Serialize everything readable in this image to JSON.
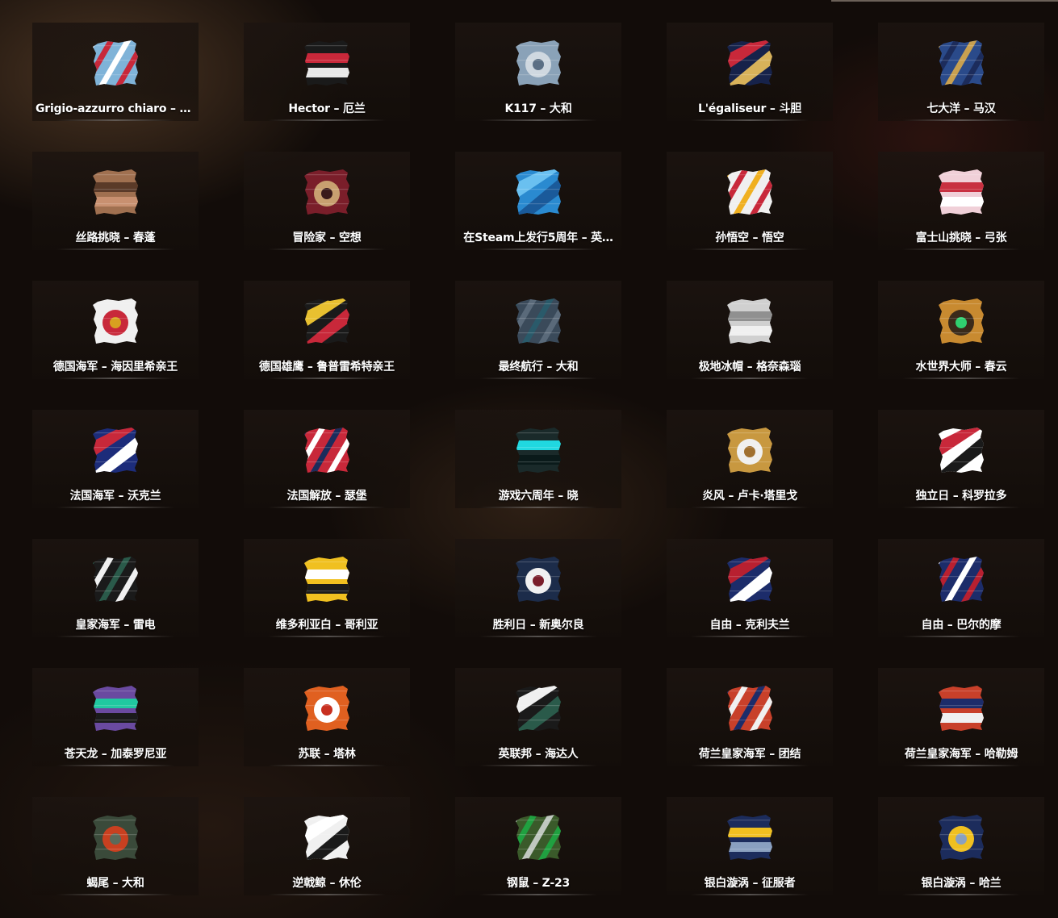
{
  "items": [
    {
      "label": "Grigio-azzurro chiaro – 威…",
      "icon": "camo-light-blue-stripes-icon",
      "colors": [
        "#7fb3d8",
        "#ffffff",
        "#c8283a"
      ]
    },
    {
      "label": "Hector – 厄兰",
      "icon": "camo-hector-turbine-icon",
      "colors": [
        "#1a1a1a",
        "#c8283a",
        "#e8e8e8"
      ]
    },
    {
      "label": "K117 – 大和",
      "icon": "camo-k117-grey-blue-icon",
      "colors": [
        "#8aa2b8",
        "#cfd8e0",
        "#5b6f84"
      ]
    },
    {
      "label": "L'égaliseur – 斗胆",
      "icon": "camo-egaliseur-navy-icon",
      "colors": [
        "#16224a",
        "#d8b25a",
        "#c8283a"
      ]
    },
    {
      "label": "七大洋 – 马汉",
      "icon": "camo-seven-seas-gold-icon",
      "colors": [
        "#2a4a8a",
        "#c8a050",
        "#1c2c5c"
      ]
    },
    {
      "label": "丝路挑晓 – 春蓬",
      "icon": "camo-silk-road-brown-icon",
      "colors": [
        "#a07050",
        "#5a3a28",
        "#c89070"
      ]
    },
    {
      "label": "冒险家 – 空想",
      "icon": "camo-adventurer-red-icon",
      "colors": [
        "#7a1e2a",
        "#c8a070",
        "#3a1a1a"
      ]
    },
    {
      "label": "在Steam上发行5周年 – 英…",
      "icon": "camo-steam-anniversary-blue-icon",
      "colors": [
        "#2a8ad0",
        "#1a5a9a",
        "#6ac0f0"
      ]
    },
    {
      "label": "孙悟空 – 悟空",
      "icon": "camo-wukong-cloud-icon",
      "colors": [
        "#f0f0f0",
        "#f0b020",
        "#c8283a"
      ]
    },
    {
      "label": "富士山挑晓 – 弓张",
      "icon": "camo-fuji-cherry-icon",
      "colors": [
        "#f0d0d8",
        "#c83040",
        "#ffffff"
      ]
    },
    {
      "label": "德国海军 – 海因里希亲王",
      "icon": "camo-german-navy-icon",
      "colors": [
        "#f0f0f0",
        "#c8283a",
        "#d8a020"
      ]
    },
    {
      "label": "德国雄鹰 – 鲁普雷希特亲王",
      "icon": "camo-german-eagle-icon",
      "colors": [
        "#1a1a1a",
        "#c8283a",
        "#e8c030"
      ]
    },
    {
      "label": "最终航行 – 大和",
      "icon": "camo-final-voyage-slate-icon",
      "colors": [
        "#3a4a5a",
        "#2a5a6a",
        "#5a6a7a"
      ]
    },
    {
      "label": "极地冰帽 – 格奈森瑙",
      "icon": "camo-polar-ice-icon",
      "colors": [
        "#d0d0d0",
        "#909090",
        "#f0f0f0"
      ]
    },
    {
      "label": "水世界大师 – 春云",
      "icon": "camo-water-master-amber-icon",
      "colors": [
        "#c88a30",
        "#3a2a1a",
        "#30d070"
      ]
    },
    {
      "label": "法国海军 – 沃克兰",
      "icon": "camo-french-navy-wave-icon",
      "colors": [
        "#1c2c7a",
        "#ffffff",
        "#c8283a"
      ]
    },
    {
      "label": "法国解放 – 瑟堡",
      "icon": "camo-french-liberation-icon",
      "colors": [
        "#c8283a",
        "#1c2c5c",
        "#ffffff"
      ]
    },
    {
      "label": "游戏六周年 – 晓",
      "icon": "camo-sixth-anniversary-chevron-icon",
      "colors": [
        "#1a2a2a",
        "#20d8e0",
        "#0a1a1a"
      ]
    },
    {
      "label": "炎风 – 卢卡·塔里戈",
      "icon": "camo-blazing-wind-gold-icon",
      "colors": [
        "#c89840",
        "#f0f0f0",
        "#a07030"
      ]
    },
    {
      "label": "独立日 – 科罗拉多",
      "icon": "camo-independence-day-icon",
      "colors": [
        "#ffffff",
        "#1a1a1a",
        "#c8283a"
      ]
    },
    {
      "label": "皇家海军 – 雷电",
      "icon": "camo-royal-navy-green-icon",
      "colors": [
        "#1a1a1a",
        "#2a5a4a",
        "#f0f0f0"
      ]
    },
    {
      "label": "维多利亚白 – 哥利亚",
      "icon": "camo-victoria-white-icon",
      "colors": [
        "#f0c020",
        "#ffffff",
        "#1a1a1a"
      ]
    },
    {
      "label": "胜利日 – 新奥尔良",
      "icon": "camo-victory-day-75-icon",
      "colors": [
        "#1c2c4a",
        "#f0f0f0",
        "#7a1e2a"
      ]
    },
    {
      "label": "自由 – 克利夫兰",
      "icon": "camo-freedom-flag-icon",
      "colors": [
        "#1c2c6a",
        "#ffffff",
        "#b82030"
      ]
    },
    {
      "label": "自由 – 巴尔的摩",
      "icon": "camo-freedom-flag-alt-icon",
      "colors": [
        "#1c2c6a",
        "#ffffff",
        "#b82030"
      ]
    },
    {
      "label": "苍天龙 – 加泰罗尼亚",
      "icon": "camo-sky-dragon-icon",
      "colors": [
        "#6a4aa0",
        "#20c8a0",
        "#1a1a1a"
      ]
    },
    {
      "label": "苏联 – 塔林",
      "icon": "camo-soviet-orange-icon",
      "colors": [
        "#e06020",
        "#ffffff",
        "#c83020"
      ]
    },
    {
      "label": "英联邦 – 海达人",
      "icon": "camo-commonwealth-green-icon",
      "colors": [
        "#1a1a1a",
        "#2a5a4a",
        "#f0f0f0"
      ]
    },
    {
      "label": "荷兰皇家海军 – 团结",
      "icon": "camo-dutch-navy-stripes-icon",
      "colors": [
        "#c8402a",
        "#1c2c6a",
        "#f0f0f0"
      ]
    },
    {
      "label": "荷兰皇家海军 – 哈勒姆",
      "icon": "camo-dutch-navy-stripes-alt-icon",
      "colors": [
        "#c8402a",
        "#1c2c6a",
        "#f0f0f0"
      ]
    },
    {
      "label": "蝎尾 – 大和",
      "icon": "camo-scorpion-tail-icon",
      "colors": [
        "#3a4a3a",
        "#c84020",
        "#5a6a5a"
      ]
    },
    {
      "label": "逆戟鲸 – 休伦",
      "icon": "camo-orca-icon",
      "colors": [
        "#f0f0f0",
        "#1a1a1a",
        "#ffffff"
      ]
    },
    {
      "label": "钢鼠 – Z-23",
      "icon": "camo-steel-rat-icon",
      "colors": [
        "#3a5a2a",
        "#c0c8c0",
        "#20a040"
      ]
    },
    {
      "label": "银白漩涡 – 征服者",
      "icon": "camo-silver-vortex-icon",
      "colors": [
        "#1c2c5c",
        "#f0c020",
        "#8aa0c0"
      ]
    },
    {
      "label": "银白漩涡 – 哈兰",
      "icon": "camo-silver-vortex-alt-icon",
      "colors": [
        "#1c2c5c",
        "#f0c020",
        "#8aa0c0"
      ]
    }
  ]
}
